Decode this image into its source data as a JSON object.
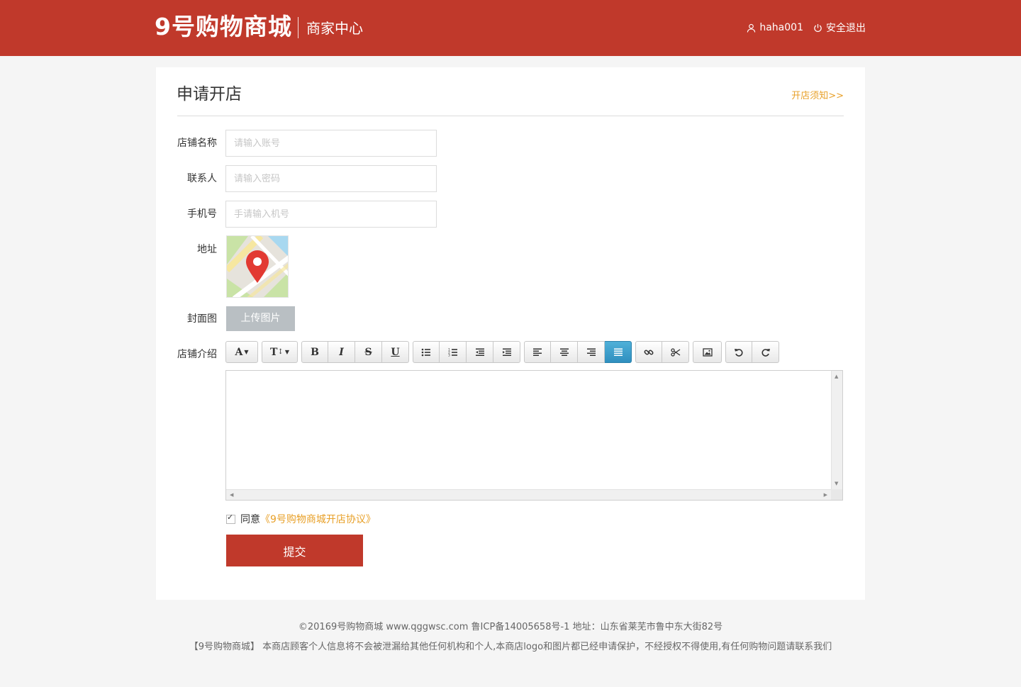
{
  "header": {
    "logo": "9号购物商城",
    "subtitle": "商家中心",
    "username": "haha001",
    "logout": "安全退出",
    "brand_color": "#c0392b"
  },
  "page": {
    "title": "申请开店",
    "notice_link": "开店须知>>"
  },
  "form": {
    "shop_name": {
      "label": "店铺名称",
      "placeholder": "请输入账号",
      "value": ""
    },
    "contact": {
      "label": "联系人",
      "placeholder": "请输入密码",
      "value": ""
    },
    "phone": {
      "label": "手机号",
      "placeholder": "手请输入机号",
      "value": ""
    },
    "address": {
      "label": "地址",
      "icon": "map-pin-icon"
    },
    "cover": {
      "label": "封面图",
      "upload_label": "上传图片"
    },
    "intro": {
      "label": "店铺介绍"
    }
  },
  "toolbar": {
    "groups": [
      [
        {
          "name": "font-family",
          "glyph": "A▾"
        }
      ],
      [
        {
          "name": "font-size",
          "glyph": "T↕▾"
        }
      ],
      [
        {
          "name": "bold",
          "glyph": "B"
        },
        {
          "name": "italic",
          "glyph": "I"
        },
        {
          "name": "strikethrough",
          "glyph": "S"
        },
        {
          "name": "underline",
          "glyph": "U"
        }
      ],
      [
        {
          "name": "bullet-list"
        },
        {
          "name": "number-list"
        },
        {
          "name": "outdent"
        },
        {
          "name": "indent"
        }
      ],
      [
        {
          "name": "align-left"
        },
        {
          "name": "align-center"
        },
        {
          "name": "align-right"
        },
        {
          "name": "justify",
          "active": true
        }
      ],
      [
        {
          "name": "link"
        },
        {
          "name": "unlink"
        }
      ],
      [
        {
          "name": "image"
        }
      ],
      [
        {
          "name": "undo"
        },
        {
          "name": "redo"
        }
      ]
    ],
    "active_color": "#3a9fd0"
  },
  "agreement": {
    "checked": true,
    "text": "同意",
    "link": "《9号购物商城开店协议》",
    "link_color": "#e8a028"
  },
  "submit_label": "提交",
  "footer": {
    "line1": "©20169号购物商城 www.qggwsc.com 鲁ICP备14005658号-1 地址：山东省莱芜市鲁中东大街82号",
    "line2": "【9号购物商城】 本商店顾客个人信息将不会被泄漏给其他任何机构和个人,本商店logo和图片都已经申请保护，不经授权不得使用,有任何购物问题请联系我们"
  }
}
